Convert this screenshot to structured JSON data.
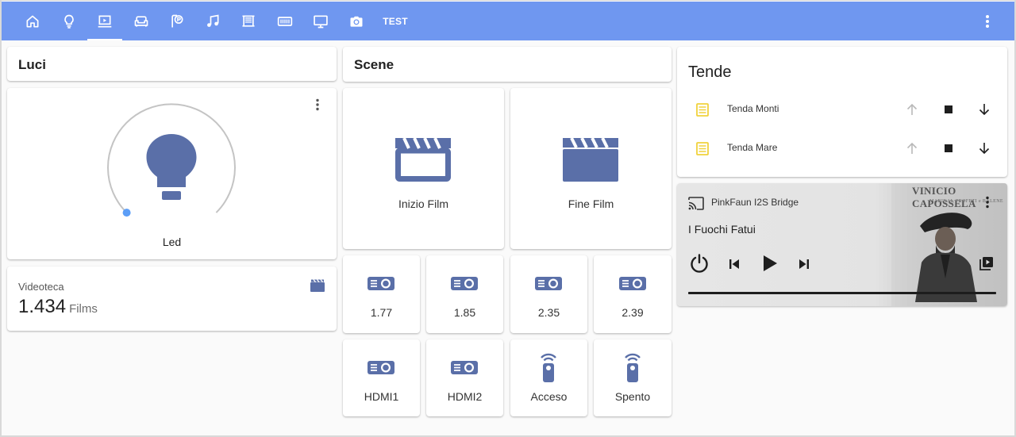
{
  "nav": {
    "tabs": [
      {
        "icon": "home-icon"
      },
      {
        "icon": "lightbulb-icon"
      },
      {
        "icon": "projector-screen-icon",
        "active": true
      },
      {
        "icon": "sofa-icon"
      },
      {
        "icon": "parking-icon"
      },
      {
        "icon": "music-note-icon"
      },
      {
        "icon": "blinds-icon"
      },
      {
        "icon": "keyboard-icon"
      },
      {
        "icon": "monitor-icon"
      },
      {
        "icon": "camera-icon"
      }
    ],
    "text_tab": "TEST",
    "menu_icon": "dots-vertical-icon",
    "color": "#6f97f0"
  },
  "luci": {
    "title": "Luci",
    "light": {
      "name": "Led",
      "icon": "lightbulb-icon",
      "color": "#5a6fa8",
      "menu_icon": "dots-vertical-icon"
    }
  },
  "videoteca": {
    "name": "Videoteca",
    "value": "1.434",
    "unit": "Films",
    "icon": "movie-icon"
  },
  "scene": {
    "title": "Scene",
    "big": [
      {
        "label": "Inizio Film",
        "icon": "movie-open-outline-icon"
      },
      {
        "label": "Fine Film",
        "icon": "movie-icon"
      }
    ],
    "row1": [
      {
        "label": "1.77",
        "icon": "projector-icon"
      },
      {
        "label": "1.85",
        "icon": "projector-icon"
      },
      {
        "label": "2.35",
        "icon": "projector-icon"
      },
      {
        "label": "2.39",
        "icon": "projector-icon"
      }
    ],
    "row2": [
      {
        "label": "HDMI1",
        "icon": "projector-icon"
      },
      {
        "label": "HDMI2",
        "icon": "projector-icon"
      },
      {
        "label": "Acceso",
        "icon": "remote-icon"
      },
      {
        "label": "Spento",
        "icon": "remote-icon"
      }
    ],
    "icon_color": "#5a6fa8"
  },
  "tende": {
    "title": "Tende",
    "items": [
      {
        "name": "Tenda Monti",
        "icon": "blinds-icon"
      },
      {
        "name": "Tenda Mare",
        "icon": "blinds-icon"
      }
    ],
    "icon_color": "#f0d23c"
  },
  "media": {
    "device": "PinkFaun I2S Bridge",
    "title": "I Fuochi Fatui",
    "album_artist": "VINICIO CAPOSSELA",
    "album_subtitle": "MARINAI, PROFETI e BALENE",
    "progress": 1.0
  }
}
